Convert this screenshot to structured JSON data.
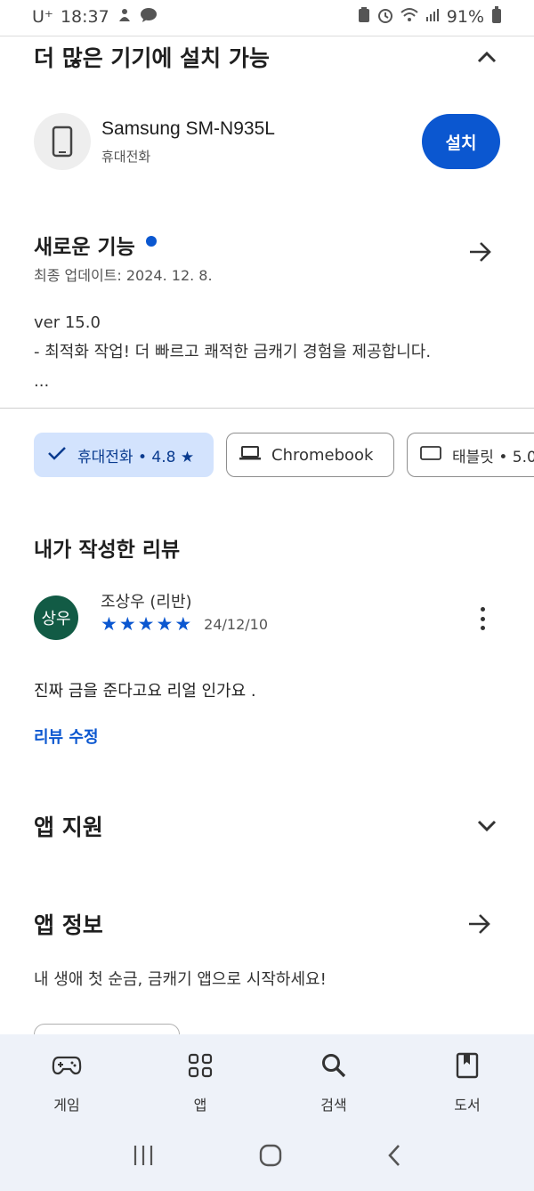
{
  "status_bar": {
    "carrier": "U⁺",
    "time": "18:37",
    "battery": "91%"
  },
  "more_devices": {
    "title": "더 많은 기기에 설치 가능",
    "device_name": "Samsung SM-N935L",
    "device_type": "휴대전화",
    "install_label": "설치"
  },
  "whats_new": {
    "title": "새로운 기능",
    "updated": "최종 업데이트: 2024. 12. 8.",
    "lines": [
      "ver 15.0",
      "- 최적화 작업! 더 빠르고 쾌적한 금캐기 경험을 제공합니다.",
      "..."
    ]
  },
  "device_chips": [
    {
      "label": "휴대전화 • 4.8 ★",
      "selected": true
    },
    {
      "label": "Chromebook",
      "selected": false
    },
    {
      "label": "태블릿 • 5.0",
      "selected": false
    }
  ],
  "my_review": {
    "title": "내가 작성한 리뷰",
    "avatar_text": "상우",
    "author": "조상우 (리반)",
    "rating": 5,
    "date": "24/12/10",
    "body": "진짜 금을 준다고요 리얼 인가요 .",
    "edit_label": "리뷰 수정"
  },
  "app_support": {
    "title": "앱 지원"
  },
  "app_info": {
    "title": "앱 정보",
    "description": "내 생애 첫 순금, 금캐기 앱으로 시작하세요!"
  },
  "bottom_nav": [
    {
      "label": "게임",
      "icon": "gamepad-icon"
    },
    {
      "label": "앱",
      "icon": "apps-grid-icon"
    },
    {
      "label": "검색",
      "icon": "search-icon"
    },
    {
      "label": "도서",
      "icon": "book-icon"
    }
  ],
  "colors": {
    "accent": "#0b57d0",
    "chip_selected_bg": "#d3e3fd",
    "avatar_bg": "#125b45",
    "nav_bg": "#eef2f9"
  }
}
